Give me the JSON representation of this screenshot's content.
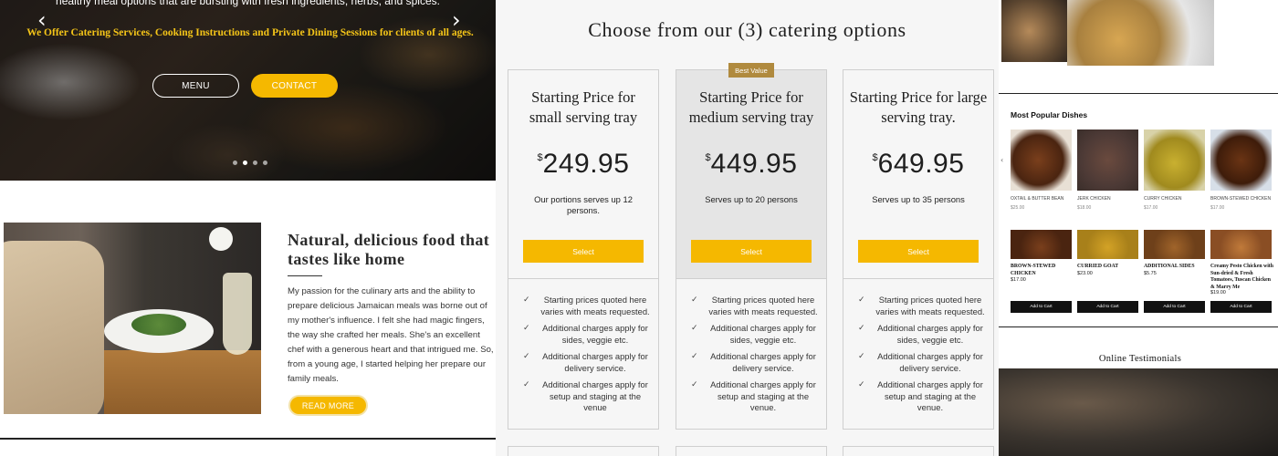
{
  "hero": {
    "intro_text": "healthy meal options that are bursting with fresh ingredients, herbs, and spices.",
    "tagline": "We Offer Catering Services, Cooking Instructions and Private Dining Sessions for clients of all ages.",
    "prev_arrow": "‹",
    "next_arrow": "›",
    "menu_label": "MENU",
    "contact_label": "CONTACT",
    "slides": 4,
    "active_slide": 2
  },
  "about": {
    "title": "Natural, delicious food that tastes like home",
    "body": "My passion for the culinary arts and the ability to prepare delicious Jamaican meals was borne out of my mother's influence.  I felt she had magic fingers, the way she crafted her meals.  She's an excellent chef with a generous heart and that intrigued me. So, from a young age, I started helping her prepare our family meals.",
    "read_more_label": "READ MORE"
  },
  "pricing": {
    "title": "Choose from our (3) catering options",
    "badge": "Best Value",
    "currency": "$",
    "select_label": "Select",
    "check_icon": "check-icon",
    "cards": [
      {
        "heading": "Starting Price for small serving tray",
        "price": "249.95",
        "serves": "Our portions serves up 12 persons.",
        "features": [
          "Starting prices quoted here varies with meats requested.",
          "Additional charges apply for sides, veggie etc.",
          "Additional charges apply for delivery service.",
          "Additional charges apply for setup and staging at the venue"
        ]
      },
      {
        "heading": "Starting Price for medium serving tray",
        "price": "449.95",
        "serves": "Serves up to 20 persons",
        "features": [
          "Starting prices quoted here varies with meats requested.",
          "Additional charges apply for sides, veggie etc.",
          "Additional charges apply for delivery service.",
          "Additional charges apply for setup and staging at the venue."
        ]
      },
      {
        "heading": "Starting Price for large serving tray.",
        "price": "649.95",
        "serves": "Serves up to 35 persons",
        "features": [
          "Starting prices quoted here varies with meats requested.",
          "Additional charges apply for sides, veggie etc.",
          "Additional charges apply for delivery service.",
          "Additional charges apply for setup and staging at the venue."
        ]
      }
    ]
  },
  "dishes": {
    "title": "Most Popular Dishes",
    "arrow": "‹",
    "cart_label": "Add to Cart",
    "top_row": [
      {
        "name": "OXTAIL & BUTTER BEAN",
        "price": "$25.00"
      },
      {
        "name": "JERK CHICKEN",
        "price": "$18.00"
      },
      {
        "name": "CURRY CHICKEN",
        "price": "$17.00"
      },
      {
        "name": "BROWN-STEWED CHICKEN",
        "price": "$17.00"
      }
    ],
    "bottom_row": [
      {
        "name": "BROWN-STEWED CHICKEN",
        "price": "$17.00"
      },
      {
        "name": "CURRIED GOAT",
        "price": "$23.00"
      },
      {
        "name": "ADDITIONAL SIDES",
        "price": "$5.75"
      },
      {
        "name": "Creamy Pesto Chicken with Sun-dried & Fresh Tomatoes, Tuscan Chicken & Marry Me",
        "price": "$19.00"
      }
    ]
  },
  "testimonials": {
    "title": "Online Testimonials"
  },
  "colors": {
    "accent": "#f5b800",
    "badge": "#b08a3e",
    "tagline": "#f5c518"
  }
}
